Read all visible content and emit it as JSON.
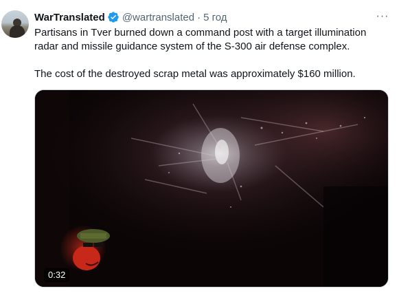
{
  "tweet": {
    "author_name": "WarTranslated",
    "handle": "@wartranslated",
    "separator": "·",
    "time": "5 год",
    "more_label": "···",
    "text_paragraphs": [
      "Partisans in Tver burned down a command post with a target illumination radar and missile guidance system of the S-300 air defense complex.",
      "The cost of the destroyed scrap metal was approximately $160 million."
    ]
  },
  "media": {
    "type": "video",
    "duration": "0:32"
  },
  "icons": {
    "verified": "verified-badge-icon",
    "more": "more-options-icon",
    "avatar": "avatar"
  },
  "colors": {
    "verified": "#1d9bf0",
    "text": "#0f1419",
    "secondary": "#536471",
    "border": "#cfd9de",
    "video_bg": "#0a0405"
  }
}
